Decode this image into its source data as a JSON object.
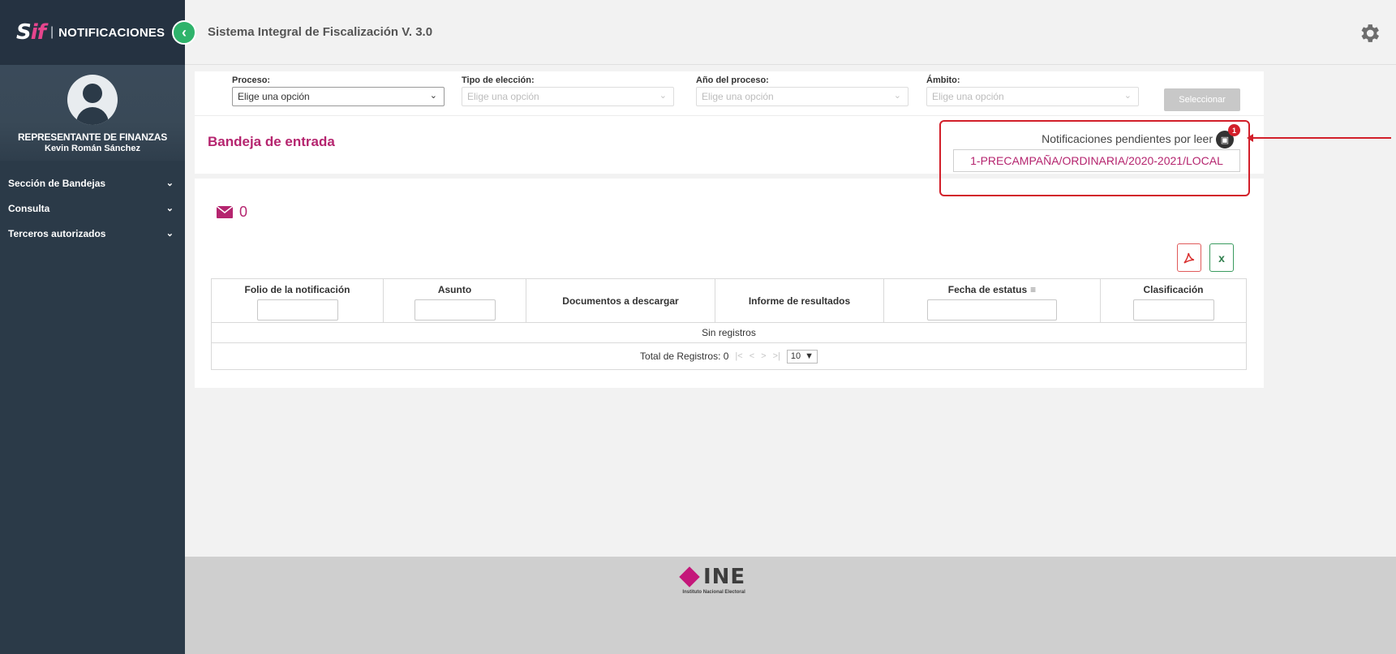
{
  "sidebar": {
    "logo_s": "S",
    "logo_if": "if",
    "separator": "|",
    "title": "NOTIFICACIONES",
    "collapse_icon": "chevron-left-icon",
    "role": "REPRESENTANTE DE FINANZAS",
    "user_name": "Kevin Román Sánchez",
    "menu": [
      {
        "label": "Sección de Bandejas",
        "icon": "chevron-down-icon"
      },
      {
        "label": "Consulta",
        "icon": "chevron-down-icon"
      },
      {
        "label": "Terceros autorizados",
        "icon": "chevron-down-icon"
      }
    ]
  },
  "header": {
    "title": "Sistema Integral de Fiscalización V. 3.0",
    "settings_icon": "gear-icon"
  },
  "filters": {
    "proceso": {
      "label": "Proceso:",
      "value": "Elige una opción"
    },
    "tipo": {
      "label": "Tipo de elección:",
      "value": "Elige una opción"
    },
    "anio": {
      "label": "Año del proceso:",
      "value": "Elige una opción"
    },
    "ambito": {
      "label": "Ámbito:",
      "value": "Elige una opción"
    },
    "button": "Seleccionar"
  },
  "inbox": {
    "title": "Bandeja de entrada",
    "count": "0"
  },
  "notifications": {
    "label": "Notificaciones pendientes por leer",
    "badge": "1",
    "item": "1-PRECAMPAÑA/ORDINARIA/2020-2021/LOCAL"
  },
  "table": {
    "columns": [
      "Folio de la notificación",
      "Asunto",
      "Documentos a descargar",
      "Informe de resultados",
      "Fecha de estatus",
      "Clasificación"
    ],
    "empty": "Sin registros",
    "total_label": "Total de Registros: 0",
    "pager_first": "|<",
    "pager_prev": "<",
    "pager_next": ">",
    "pager_last": ">|",
    "per_page": "10"
  },
  "export": {
    "xls_label": "x"
  },
  "footer": {
    "logo": "INE",
    "subtitle": "Instituto Nacional Electoral"
  },
  "colors": {
    "sidebar": "#2b3a48",
    "accent": "#b5256f",
    "annotation": "#d21f2a",
    "collapse": "#2fb36b"
  }
}
